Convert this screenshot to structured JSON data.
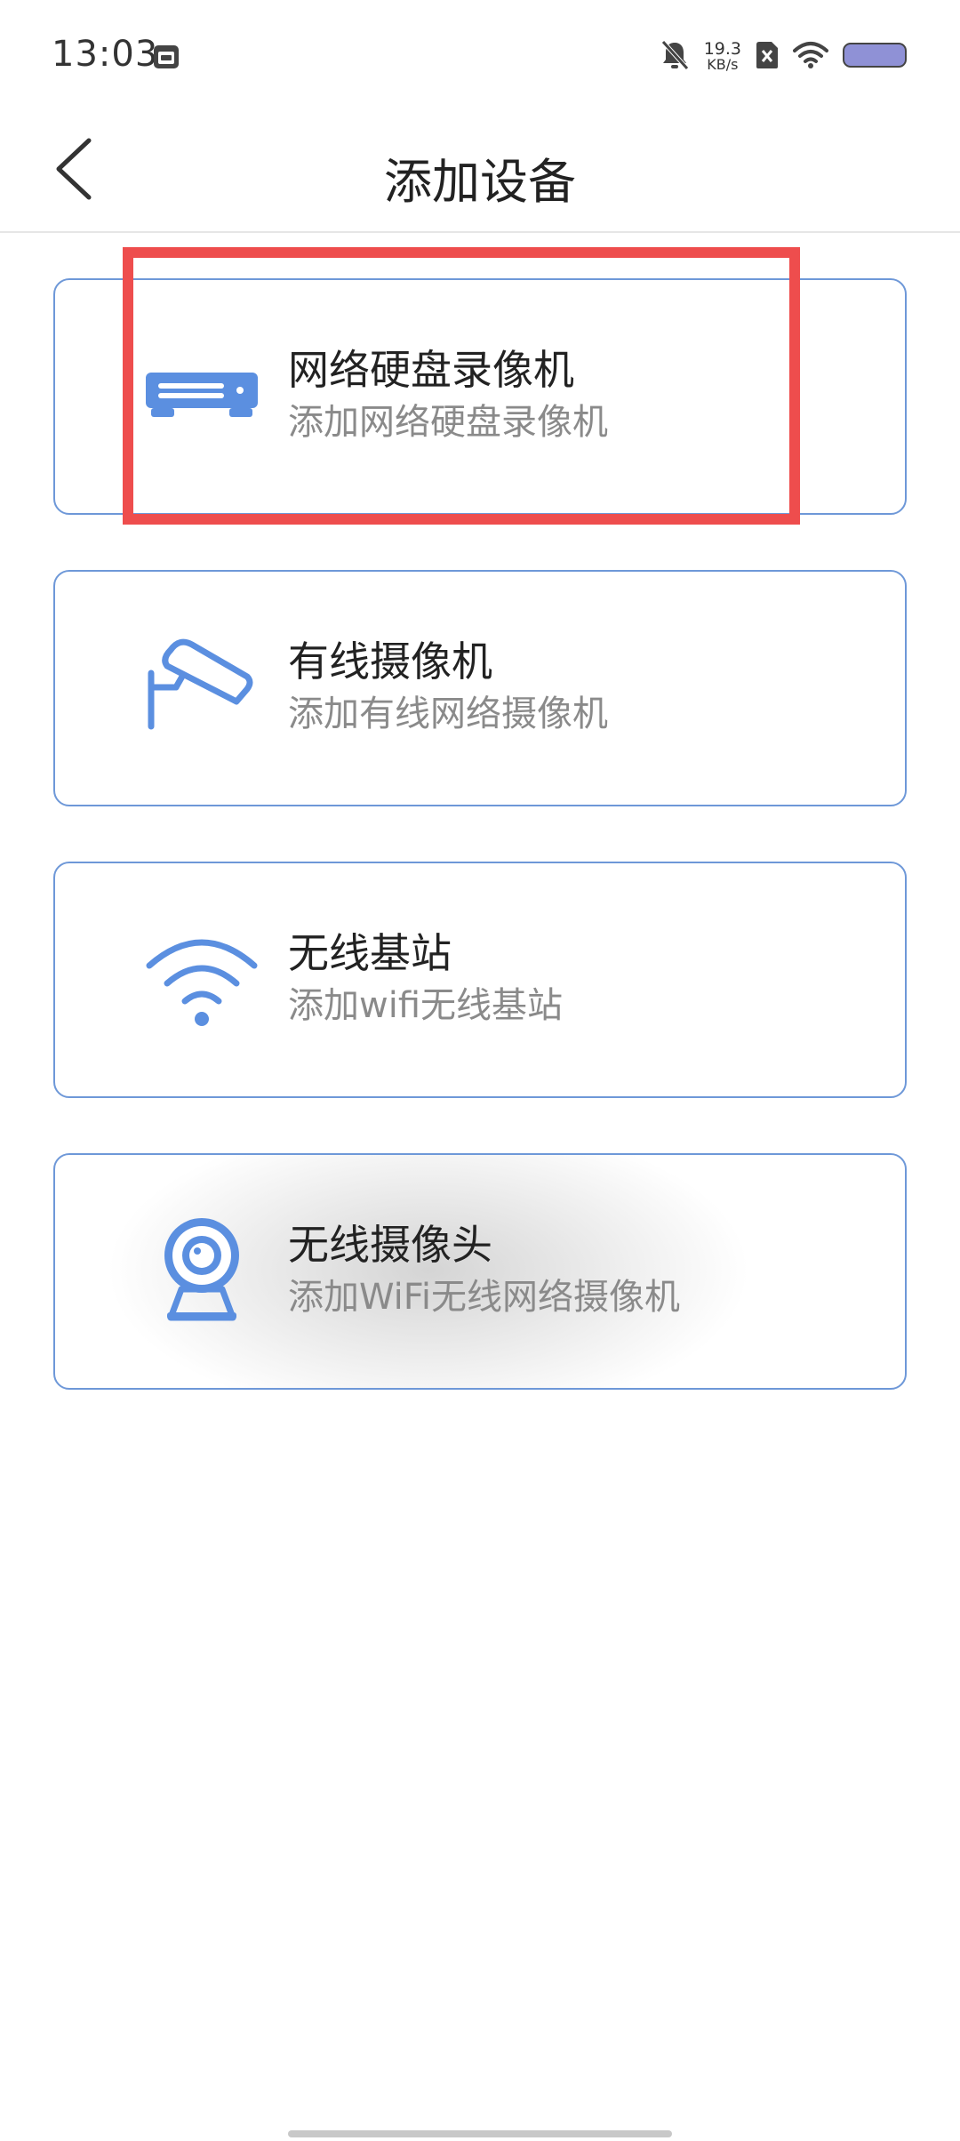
{
  "status_bar": {
    "time": "13:03",
    "net_speed_value": "19.3",
    "net_speed_unit": "KB/s",
    "icons": [
      "calendar-icon",
      "mute-icon",
      "sim-off-icon",
      "wifi-icon",
      "battery-icon"
    ]
  },
  "header": {
    "title": "添加设备",
    "back_icon": "chevron-left-icon"
  },
  "devices": [
    {
      "title": "网络硬盘录像机",
      "subtitle": "添加网络硬盘录像机",
      "icon": "nvr-icon"
    },
    {
      "title": "有线摄像机",
      "subtitle": "添加有线网络摄像机",
      "icon": "wired-camera-icon"
    },
    {
      "title": "无线基站",
      "subtitle": "添加wifi无线基站",
      "icon": "wifi-base-station-icon"
    },
    {
      "title": "无线摄像头",
      "subtitle": "添加WiFi无线网络摄像机",
      "icon": "webcam-icon"
    }
  ],
  "colors": {
    "accent": "#5b8fe0",
    "card_border": "#6e98d8",
    "highlight": "#ee4d4d",
    "subtitle_text": "#8a8a8a"
  }
}
